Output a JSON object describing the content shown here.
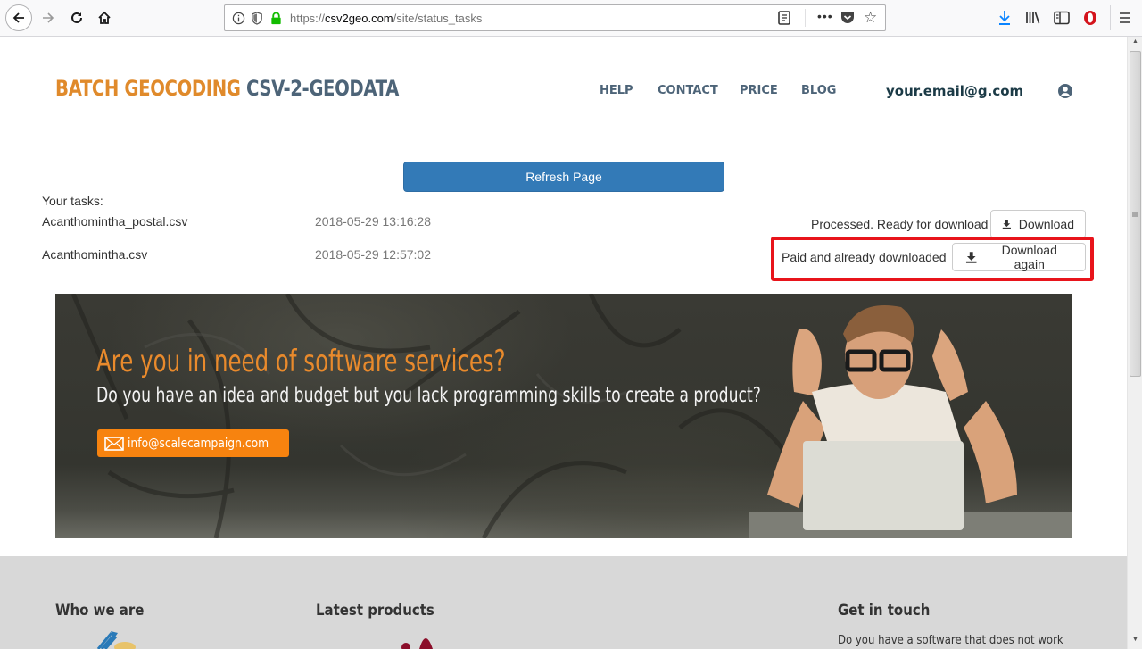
{
  "browser": {
    "url_scheme": "https://",
    "url_host": "csv2geo.com",
    "url_path": "/site/status_tasks",
    "icons": [
      "back-icon",
      "forward-icon",
      "reload-icon",
      "home-icon",
      "info-icon",
      "shield-icon",
      "lock-icon",
      "reader-view-icon",
      "more-icon",
      "pocket-icon",
      "bookmark-star-icon",
      "download-icon",
      "library-icon",
      "sidebar-icon",
      "opera-icon",
      "menu-icon"
    ],
    "accent_download": "#0a84ff",
    "lock_color": "#12bc00"
  },
  "header": {
    "logo_part1": "BATCH GEOCODING",
    "logo_part2": "CSV-2-GEODATA",
    "nav": {
      "help": "HELP",
      "contact": "CONTACT",
      "price": "PRICE",
      "blog": "BLOG"
    },
    "user_email": "your.email@g.com"
  },
  "main": {
    "refresh_label": "Refresh Page",
    "tasks_label": "Your tasks:",
    "tasks": [
      {
        "name": "Acanthomintha_postal.csv",
        "date": "2018-05-29 13:16:28",
        "status": "Processed. Ready for download",
        "button": "Download"
      },
      {
        "name": "Acanthomintha.csv",
        "date": "2018-05-29 12:57:02",
        "status": "Paid and already downloaded",
        "button": "Download again"
      }
    ],
    "highlight_color": "#e8141b",
    "primary_color": "#337ab7"
  },
  "banner": {
    "title": "Are you in need of software services?",
    "subtitle": "Do you have an idea and budget but you lack programming skills to create a product?",
    "email": "info@scalecampaign.com"
  },
  "footer": {
    "who_we_are": "Who we are",
    "latest_products": "Latest products",
    "get_in_touch": "Get in touch",
    "get_in_touch_text": "Do you have a software that does not work"
  }
}
